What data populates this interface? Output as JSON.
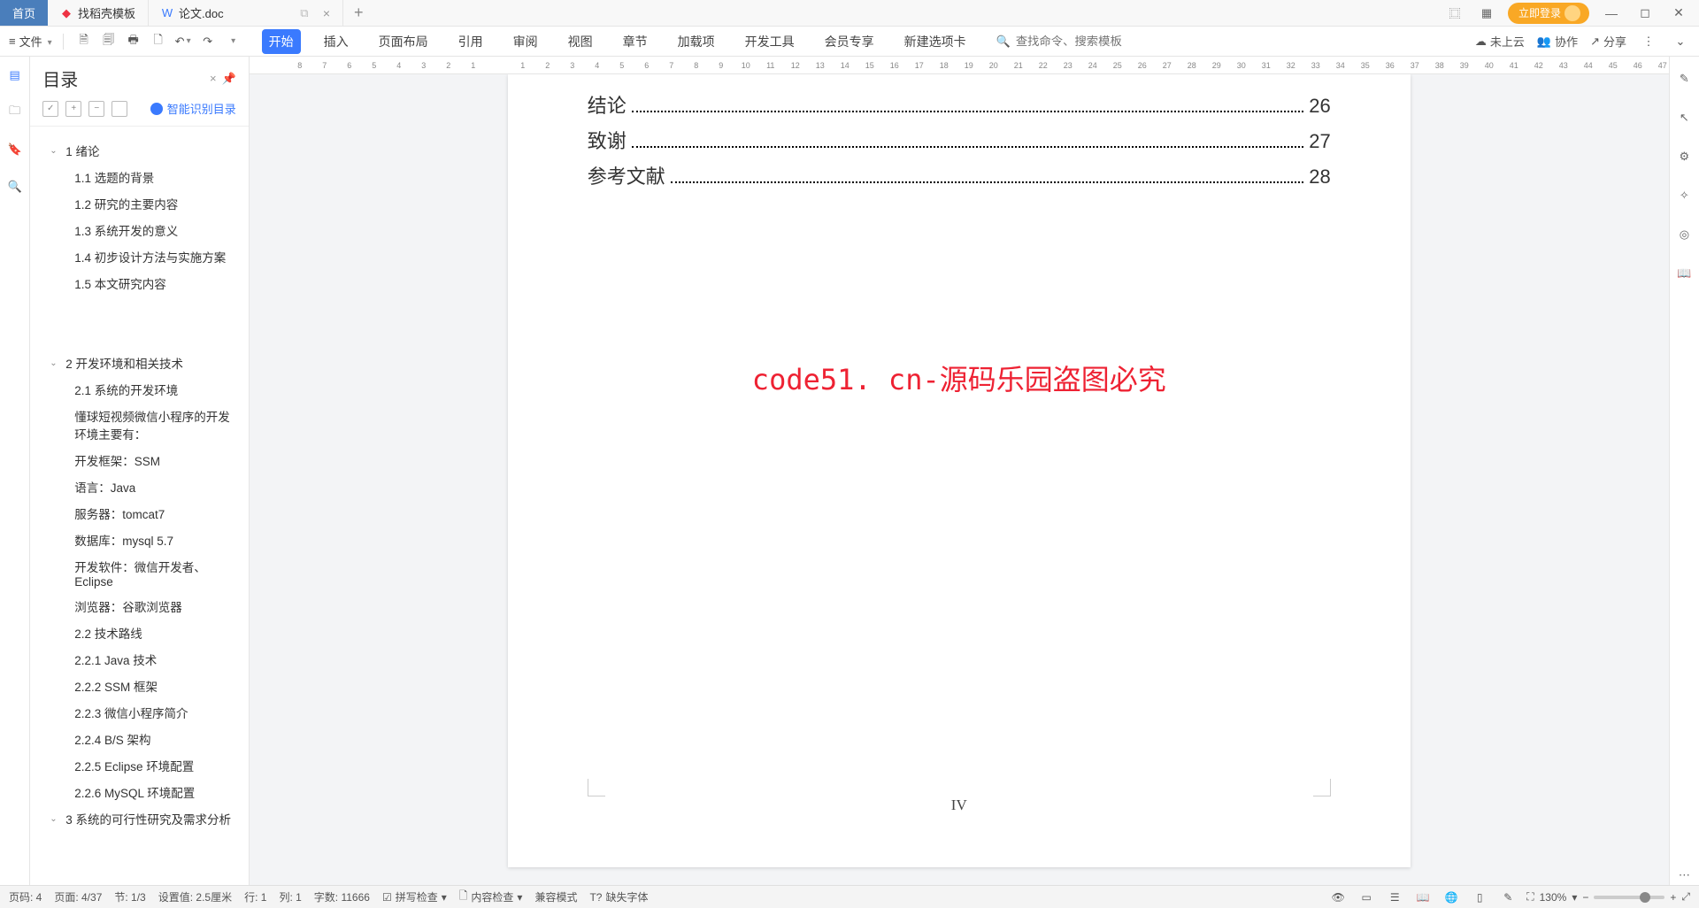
{
  "tabs": {
    "home": "首页",
    "template": "找稻壳模板",
    "doc": "论文.doc"
  },
  "login": "立即登录",
  "fileMenu": "文件",
  "ribbon": [
    "开始",
    "插入",
    "页面布局",
    "引用",
    "审阅",
    "视图",
    "章节",
    "加载项",
    "开发工具",
    "会员专享",
    "新建选项卡"
  ],
  "searchPlaceholder": "查找命令、搜索模板",
  "cloud": "未上云",
  "collab": "协作",
  "share": "分享",
  "outline": {
    "title": "目录",
    "smart": "智能识别目录",
    "items": [
      {
        "lvl": 1,
        "caret": true,
        "label": "1  绪论"
      },
      {
        "lvl": 2,
        "label": "1.1  选题的背景"
      },
      {
        "lvl": 2,
        "label": "1.2  研究的主要内容"
      },
      {
        "lvl": 2,
        "label": "1.3  系统开发的意义"
      },
      {
        "lvl": 2,
        "label": "1.4  初步设计方法与实施方案"
      },
      {
        "lvl": 2,
        "label": "1.5  本文研究内容"
      },
      {
        "lvl": 0,
        "label": ""
      },
      {
        "lvl": 1,
        "caret": true,
        "label": "2  开发环境和相关技术"
      },
      {
        "lvl": 2,
        "label": "2.1  系统的开发环境"
      },
      {
        "lvl": 2,
        "label": "懂球短视频微信小程序的开发环境主要有："
      },
      {
        "lvl": 2,
        "label": "开发框架：SSM"
      },
      {
        "lvl": 2,
        "label": "语言：Java"
      },
      {
        "lvl": 2,
        "label": "服务器：tomcat7"
      },
      {
        "lvl": 2,
        "label": "数据库：mysql 5.7"
      },
      {
        "lvl": 2,
        "label": "开发软件：微信开发者、Eclipse"
      },
      {
        "lvl": 2,
        "label": "浏览器：谷歌浏览器"
      },
      {
        "lvl": 2,
        "label": "2.2  技术路线"
      },
      {
        "lvl": 2,
        "label": "2.2.1 Java 技术"
      },
      {
        "lvl": 2,
        "label": "2.2.2 SSM 框架"
      },
      {
        "lvl": 2,
        "label": "2.2.3 微信小程序简介"
      },
      {
        "lvl": 2,
        "label": "2.2.4 B/S 架构"
      },
      {
        "lvl": 2,
        "label": "2.2.5 Eclipse 环境配置"
      },
      {
        "lvl": 2,
        "label": "2.2.6 MySQL 环境配置"
      },
      {
        "lvl": 1,
        "caret": true,
        "label": "3  系统的可行性研究及需求分析"
      }
    ]
  },
  "ruler": [
    "8",
    "7",
    "6",
    "5",
    "4",
    "3",
    "2",
    "1",
    "",
    "1",
    "2",
    "3",
    "4",
    "5",
    "6",
    "7",
    "8",
    "9",
    "10",
    "11",
    "12",
    "13",
    "14",
    "15",
    "16",
    "17",
    "18",
    "19",
    "20",
    "21",
    "22",
    "23",
    "24",
    "25",
    "26",
    "27",
    "28",
    "29",
    "30",
    "31",
    "32",
    "33",
    "34",
    "35",
    "36",
    "37",
    "38",
    "39",
    "40",
    "41",
    "42",
    "43",
    "44",
    "45",
    "46",
    "47"
  ],
  "toc": [
    {
      "label": "结论",
      "page": "26"
    },
    {
      "label": "致谢",
      "page": "27"
    },
    {
      "label": "参考文献",
      "page": "28"
    }
  ],
  "watermark": "code51. cn-源码乐园盗图必究",
  "pageNum": "IV",
  "status": {
    "page": "页码: 4",
    "pages": "页面: 4/37",
    "section": "节: 1/3",
    "setting": "设置值: 2.5厘米",
    "row": "行: 1",
    "col": "列: 1",
    "words": "字数: 11666",
    "spell": "拼写检查",
    "content": "内容检查",
    "compat": "兼容模式",
    "missing": "缺失字体",
    "zoom": "130%"
  }
}
